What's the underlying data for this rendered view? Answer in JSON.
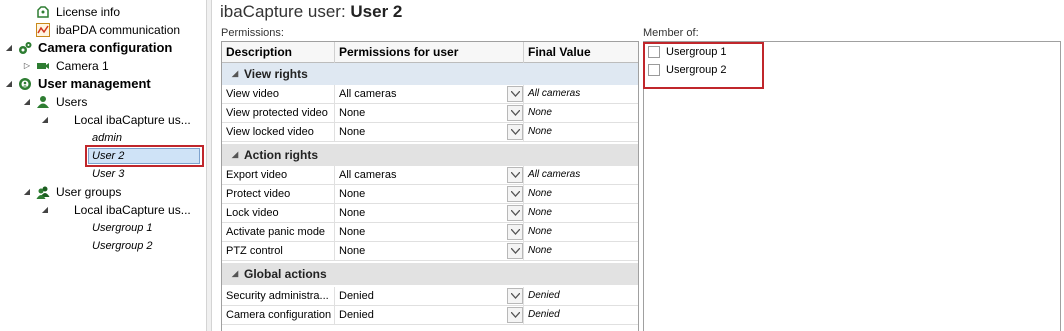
{
  "tree": {
    "license_info": "License info",
    "ibapda_comm": "ibaPDA communication",
    "camera_config": "Camera configuration",
    "camera_1": "Camera 1",
    "user_management": "User management",
    "users": "Users",
    "local_users": "Local ibaCapture us...",
    "admin": "admin",
    "user2": "User 2",
    "user3": "User 3",
    "user_groups": "User groups",
    "local_groups": "Local ibaCapture us...",
    "usergroup1": "Usergroup 1",
    "usergroup2": "Usergroup 2"
  },
  "header": {
    "prefix": "ibaCapture user: ",
    "name": "User 2",
    "permissions_caption": "Permissions:",
    "member_caption": "Member of:"
  },
  "grid": {
    "columns": [
      "Description",
      "Permissions for user",
      "Final Value"
    ],
    "sections": [
      {
        "title": "View rights",
        "rows": [
          {
            "description": "View video",
            "permission": "All cameras",
            "final": "All cameras"
          },
          {
            "description": "View protected video",
            "permission": "None",
            "final": "None"
          },
          {
            "description": "View locked video",
            "permission": "None",
            "final": "None"
          }
        ]
      },
      {
        "title": "Action rights",
        "rows": [
          {
            "description": "Export video",
            "permission": "All cameras",
            "final": "All cameras"
          },
          {
            "description": "Protect video",
            "permission": "None",
            "final": "None"
          },
          {
            "description": "Lock video",
            "permission": "None",
            "final": "None"
          },
          {
            "description": "Activate panic mode",
            "permission": "None",
            "final": "None"
          },
          {
            "description": "PTZ control",
            "permission": "None",
            "final": "None"
          }
        ]
      },
      {
        "title": "Global actions",
        "rows": [
          {
            "description": "Security administra...",
            "permission": "Denied",
            "final": "Denied"
          },
          {
            "description": "Camera configuration",
            "permission": "Denied",
            "final": "Denied"
          }
        ]
      }
    ]
  },
  "member_of": [
    {
      "label": "Usergroup 1",
      "checked": false
    },
    {
      "label": "Usergroup 2",
      "checked": false
    }
  ],
  "colors": {
    "highlight_border": "#c0262b",
    "selection_fill": "#cfe3f7",
    "icon_green": "#2e7d32"
  }
}
